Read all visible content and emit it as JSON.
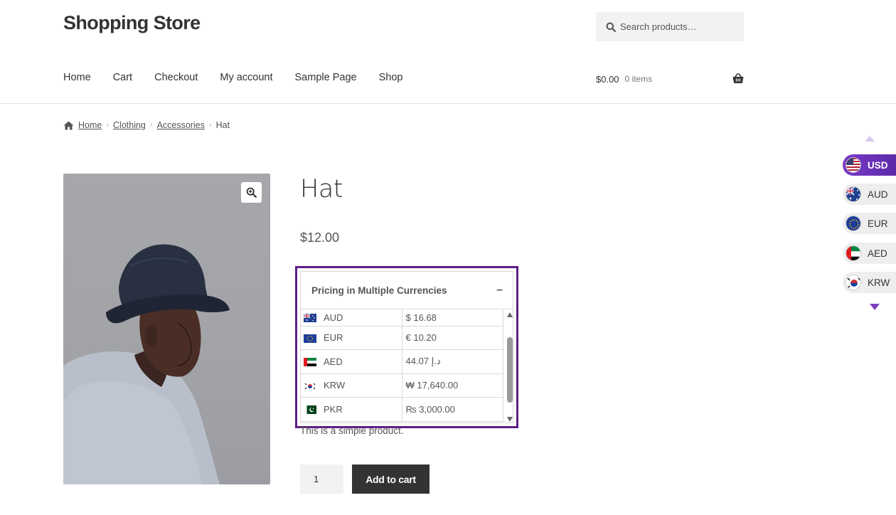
{
  "site": {
    "title": "Shopping Store"
  },
  "search": {
    "placeholder": "Search products…",
    "icon": "search-icon"
  },
  "nav": {
    "items": [
      "Home",
      "Cart",
      "Checkout",
      "My account",
      "Sample Page",
      "Shop"
    ]
  },
  "cart": {
    "amount": "$0.00",
    "items": "0 items",
    "icon": "basket-icon"
  },
  "breadcrumb": {
    "items": [
      "Home",
      "Clothing",
      "Accessories"
    ],
    "current": "Hat"
  },
  "product": {
    "title": "Hat",
    "price": "$12.00",
    "short_description": "This is a simple product.",
    "quantity": "1",
    "add_to_cart_label": "Add to cart"
  },
  "currency_panel": {
    "title": "Pricing in Multiple Currencies",
    "toggle": "–",
    "rows": [
      {
        "code": "AUD",
        "value": "$ 16.68"
      },
      {
        "code": "EUR",
        "value": "€ 10.20"
      },
      {
        "code": "AED",
        "value": "د.إ 44.07"
      },
      {
        "code": "KRW",
        "value": "₩ 17,640.00"
      },
      {
        "code": "PKR",
        "value": "₨ 3,000.00"
      }
    ]
  },
  "currency_switcher": {
    "items": [
      {
        "code": "USD",
        "active": true
      },
      {
        "code": "AUD",
        "active": false
      },
      {
        "code": "EUR",
        "active": false
      },
      {
        "code": "AED",
        "active": false
      },
      {
        "code": "KRW",
        "active": false
      }
    ]
  },
  "colors": {
    "accent": "#5b1f86",
    "button": "#333333",
    "switcher_active": "#6a32b8"
  }
}
